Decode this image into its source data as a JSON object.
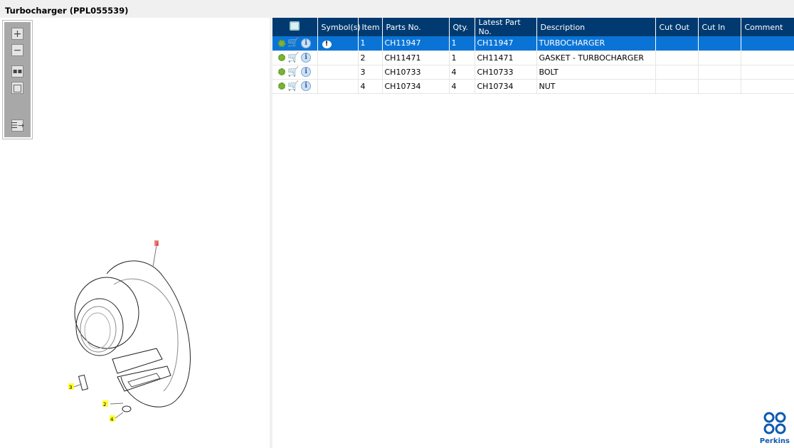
{
  "title": "Turbocharger (PPL055539)",
  "toolbar": {
    "zoom_in": "zoom-in",
    "zoom_out": "zoom-out",
    "fit": "fit-all",
    "window": "zoom-window",
    "toggle": "toggle-list"
  },
  "table": {
    "headers": [
      "",
      "Symbol(s)",
      "Item",
      "Parts No.",
      "Qty.",
      "Latest Part No.",
      "Description",
      "Cut Out",
      "Cut In",
      "Comment"
    ],
    "rows": [
      {
        "symbol": "!",
        "item": "1",
        "part": "CH11947",
        "qty": "1",
        "latest": "CH11947",
        "desc": "TURBOCHARGER",
        "cutout": "",
        "cutin": "",
        "comment": ""
      },
      {
        "symbol": "",
        "item": "2",
        "part": "CH11471",
        "qty": "1",
        "latest": "CH11471",
        "desc": "GASKET - TURBOCHARGER",
        "cutout": "",
        "cutin": "",
        "comment": ""
      },
      {
        "symbol": "",
        "item": "3",
        "part": "CH10733",
        "qty": "4",
        "latest": "CH10733",
        "desc": "BOLT",
        "cutout": "",
        "cutin": "",
        "comment": ""
      },
      {
        "symbol": "",
        "item": "4",
        "part": "CH10734",
        "qty": "4",
        "latest": "CH10734",
        "desc": "NUT",
        "cutout": "",
        "cutin": "",
        "comment": ""
      }
    ]
  },
  "callouts": [
    "1",
    "2",
    "3",
    "4"
  ],
  "brand": "Perkins",
  "colors": {
    "header": "#003a70",
    "selected": "#0a74d6",
    "callout_selected": "#f08080",
    "callout": "#ffff33"
  }
}
